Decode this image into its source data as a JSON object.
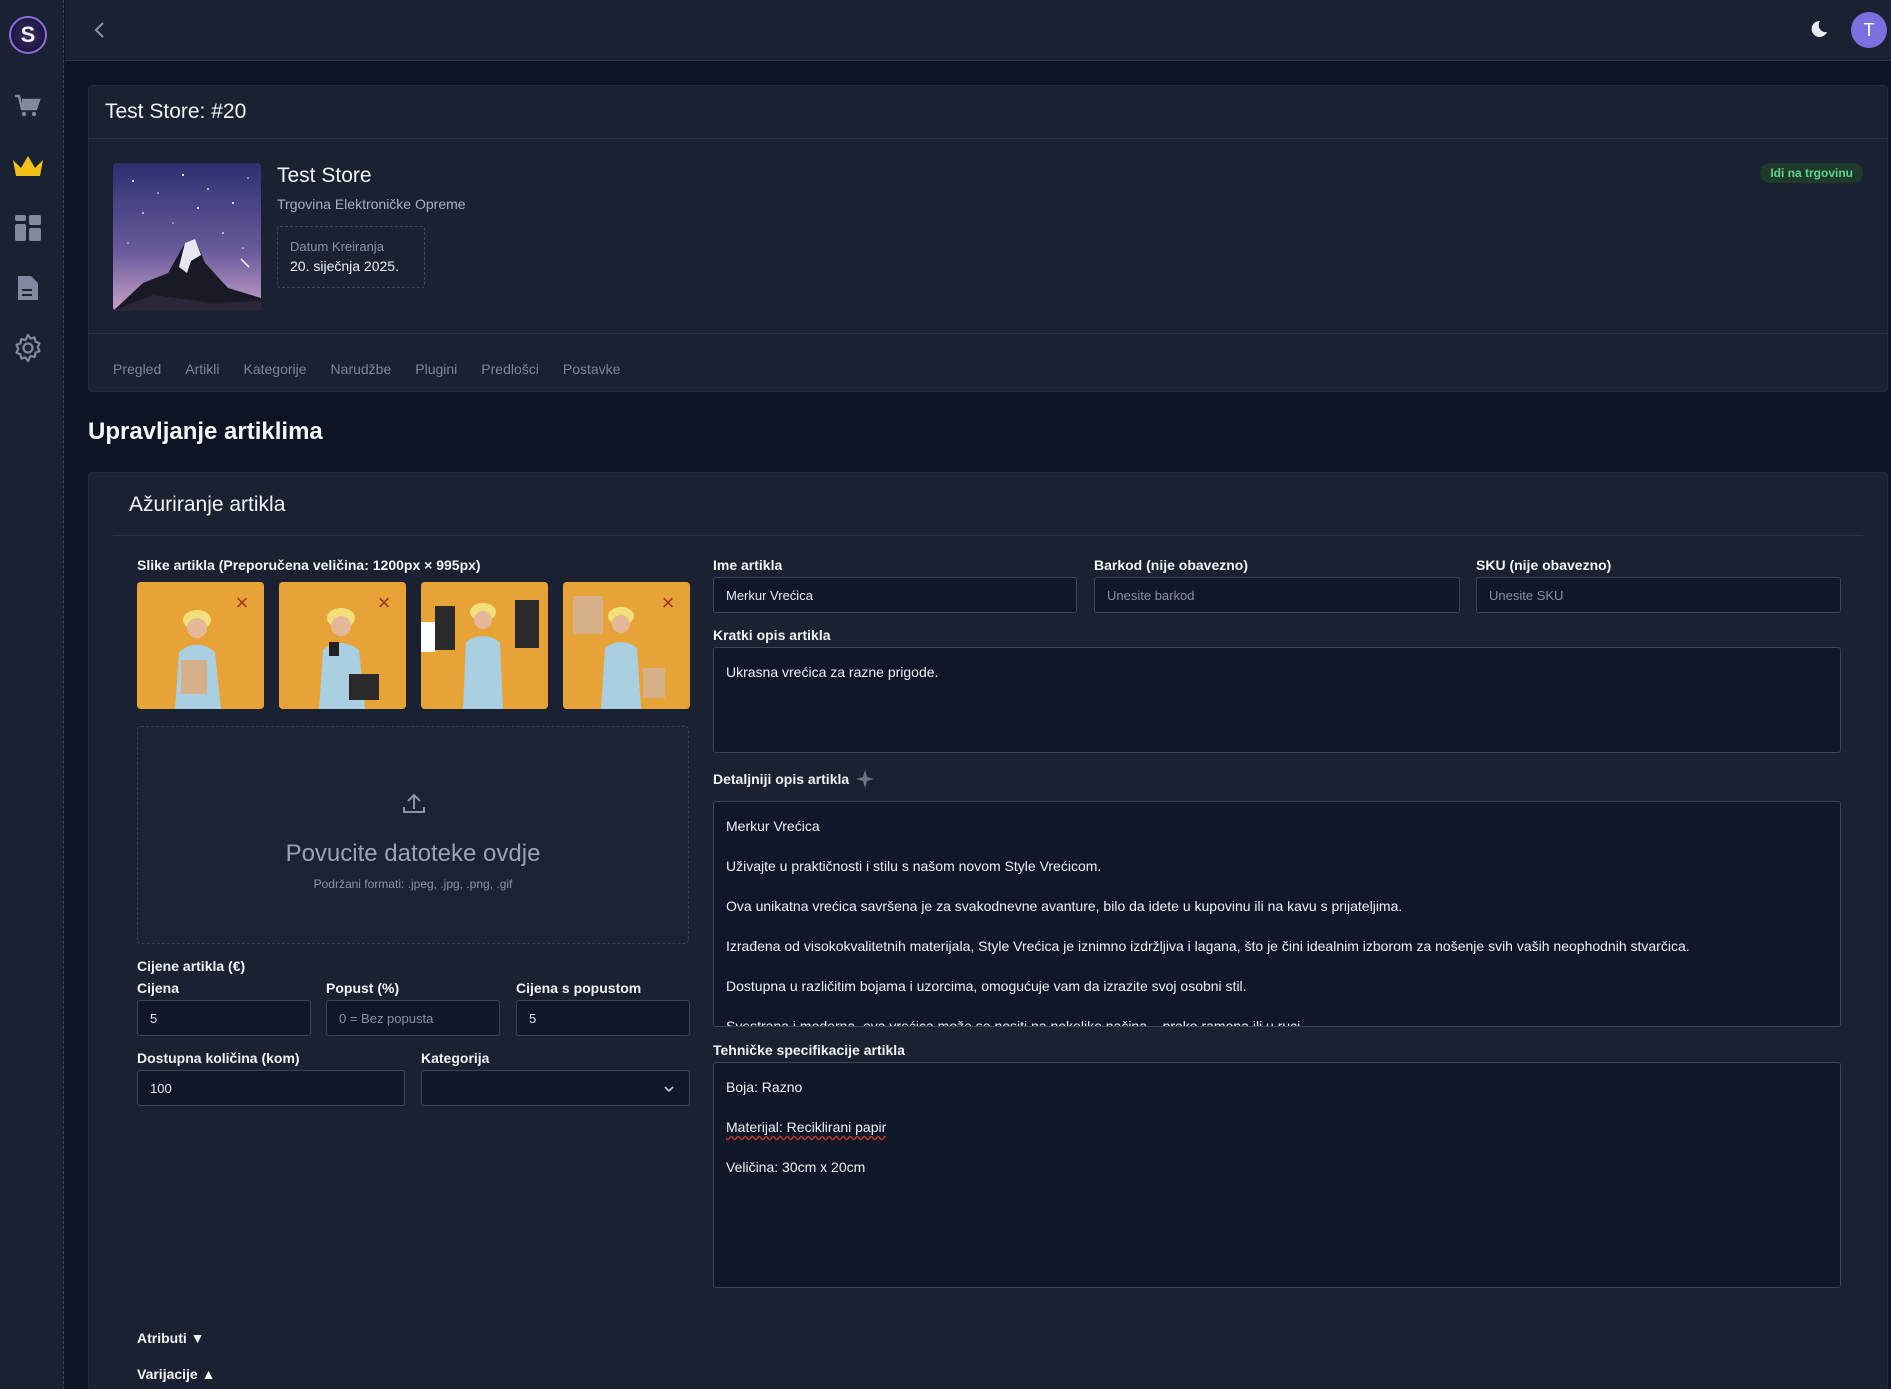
{
  "sidebar": {
    "logo_letter": "S",
    "items": [
      {
        "name": "cart-icon"
      },
      {
        "name": "crown-icon"
      },
      {
        "name": "dashboard-icon"
      },
      {
        "name": "document-icon"
      },
      {
        "name": "settings-icon"
      }
    ]
  },
  "topbar": {
    "avatar_letter": "T"
  },
  "store": {
    "card_title": "Test Store: #20",
    "name": "Test Store",
    "subtitle": "Trgovina Elektroničke Opreme",
    "date_label": "Datum Kreiranja",
    "date_value": "20. siječnja 2025.",
    "goto_label": "Idi na trgovinu",
    "tabs": [
      "Pregled",
      "Artikli",
      "Kategorije",
      "Narudžbe",
      "Plugini",
      "Predlošci",
      "Postavke"
    ]
  },
  "page": {
    "title": "Upravljanje artiklima"
  },
  "form": {
    "card_title": "Ažuriranje artikla",
    "images_label": "Slike artikla (Preporučena veličina: 1200px × 995px)",
    "dropzone_title": "Povucite datoteke ovdje",
    "dropzone_sub": "Podržani formati: .jpeg, .jpg, .png, .gif",
    "prices_label": "Cijene artikla (€)",
    "price_label": "Cijena",
    "price_value": "5",
    "discount_label": "Popust (%)",
    "discount_placeholder": "0 = Bez popusta",
    "discounted_label": "Cijena s popustom",
    "discounted_value": "5",
    "quantity_label": "Dostupna količina (kom)",
    "quantity_value": "100",
    "category_label": "Kategorija",
    "category_value": "",
    "name_label": "Ime artikla",
    "name_value": "Merkur Vrećica",
    "barcode_label": "Barkod (nije obavezno)",
    "barcode_placeholder": "Unesite barkod",
    "sku_label": "SKU (nije obavezno)",
    "sku_placeholder": "Unesite SKU",
    "short_desc_label": "Kratki opis artikla",
    "short_desc_value": "Ukrasna vrećica za razne prigode.",
    "long_desc_label": "Detaljniji opis artikla",
    "long_desc_lines": [
      "Merkur Vrećica",
      "Uživajte u praktičnosti i stilu s našom novom Style Vrećicom.",
      "Ova unikatna vrećica savršena je za svakodnevne avanture, bilo da idete u kupovinu ili na kavu s prijateljima.",
      "Izrađena od visokokvalitetnih materijala, Style Vrećica je iznimno izdržljiva i lagana, što je čini idealnim izborom za nošenje svih vaših neophodnih stvarčica.",
      "Dostupna u različitim bojama i uzorcima, omogućuje vam da izrazite svoj osobni stil.",
      "Svestrana i moderna, ova vrećica može se nositi na nekoliko načina – preko ramena ili u ruci."
    ],
    "tech_label": "Tehničke specifikacije artikla",
    "tech_lines": [
      "Boja: Razno",
      "Materijal: Reciklirani papir",
      "Veličina: 30cm x 20cm"
    ],
    "attributes_toggle": "Atributi ▼",
    "variations_toggle": "Varijacije ▲"
  },
  "colors": {
    "bg": "#0d1424",
    "panel": "#1a2130",
    "accent": "#7c6fe0",
    "success": "#5fd38a",
    "danger": "#a0341f"
  }
}
